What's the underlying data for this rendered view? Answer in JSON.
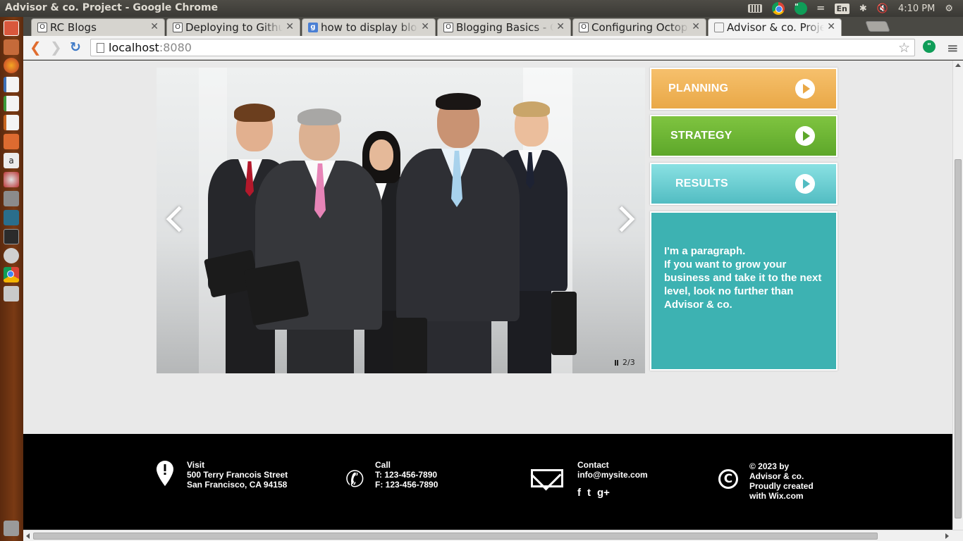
{
  "window": {
    "title": "Advisor & co. Project - Google Chrome"
  },
  "system_tray": {
    "language": "En",
    "clock": "4:10 PM"
  },
  "tabs": [
    {
      "title": "RC Blogs",
      "favicon": "o-doc-icon"
    },
    {
      "title": "Deploying to Github",
      "favicon": "o-doc-icon"
    },
    {
      "title": "how to display blogs",
      "favicon": "google-icon"
    },
    {
      "title": "Blogging Basics - Oc",
      "favicon": "o-doc-icon"
    },
    {
      "title": "Configuring Octopre",
      "favicon": "o-doc-icon"
    },
    {
      "title": "Advisor & co. Project",
      "favicon": "page-icon"
    }
  ],
  "toolbar": {
    "url_host": "localhost",
    "url_port": ":8080"
  },
  "slideshow": {
    "counter": "2/3"
  },
  "side_buttons": [
    {
      "label": "PLANNING",
      "color": "#f0b25a"
    },
    {
      "label": "STRATEGY",
      "color": "#6db535"
    },
    {
      "label": "RESULTS",
      "color": "#6fd0d3"
    }
  ],
  "info_box": {
    "line1": "I'm a paragraph.",
    "line2": "If you want to grow your business and take it to the next level, look no further than Advisor & co.",
    "color": "#3db2b2"
  },
  "footer": {
    "visit": {
      "heading": "Visit",
      "line1": "500 Terry Francois Street",
      "line2": "San Francisco, CA 94158"
    },
    "call": {
      "heading": "Call",
      "line1": "T: 123-456-7890",
      "line2": "F: 123-456-7890"
    },
    "contact": {
      "heading": "Contact",
      "email": "info@mysite.com"
    },
    "social": {
      "facebook": "f",
      "twitter": "t",
      "gplus": "g+"
    },
    "copyright": {
      "line1": "© 2023 by",
      "line2": "Advisor & co.",
      "line3": "Proudly created",
      "line4": "with Wix.com"
    }
  }
}
